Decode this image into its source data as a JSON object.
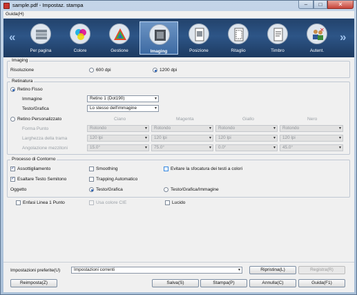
{
  "window": {
    "title": "sample.pdf - Impostaz. stampa",
    "min": "–",
    "max": "□",
    "close": "✕"
  },
  "menu": {
    "guida": "Guida(H)"
  },
  "toolbar": {
    "left": "«",
    "right": "»",
    "items": [
      {
        "label": "Per pagina",
        "icon": "pages-stack-icon"
      },
      {
        "label": "Colore",
        "icon": "color-circles-icon"
      },
      {
        "label": "Gestione",
        "icon": "color-management-icon"
      },
      {
        "label": "Imaging",
        "icon": "imaging-icon",
        "selected": true
      },
      {
        "label": "Posizione",
        "icon": "position-icon"
      },
      {
        "label": "Ritaglio",
        "icon": "crop-icon"
      },
      {
        "label": "Timbro",
        "icon": "stamp-icon"
      },
      {
        "label": "Autent.",
        "icon": "users-auth-icon"
      }
    ]
  },
  "imaging": {
    "title": "Imaging",
    "risoluzione": "Risoluzione",
    "dpi600": "600 dpi",
    "dpi1200": "1200 dpi"
  },
  "retinatura": {
    "title": "Retinatura",
    "fisso": "Retino Fisso",
    "immagine": "Immagine",
    "immagine_val": "Retino 1 (Dot190)",
    "grafica": "Testo/Grafica",
    "grafica_val": "Lo stesso dell'immagine",
    "personalizzato": "Retino Personalizzato",
    "cols": [
      "Ciano",
      "Magenta",
      "Giallo",
      "Nero"
    ],
    "rows": [
      {
        "label": "Forma Punto",
        "vals": [
          "Rotondo",
          "Rotondo",
          "Rotondo",
          "Rotondo"
        ]
      },
      {
        "label": "Larghezza della trama",
        "vals": [
          "120 lpi",
          "120 lpi",
          "120 lpi",
          "120 lpi"
        ]
      },
      {
        "label": "Angolazione mezzitoni",
        "vals": [
          "15.0°",
          "75.0°",
          "0.0°",
          "45.0°"
        ]
      }
    ]
  },
  "contorno": {
    "title": "Processo di Contorno",
    "assottigliamento": "Assottigliamento",
    "smoothing": "Smoothing",
    "evitare": "Evitare la sfocatura dei testi a colori",
    "esaltare": "Esaltare Testo Semitono",
    "trapping": "Trapping Automatico",
    "oggetto": "Oggetto",
    "tg": "Testo/Grafica",
    "tgi": "Testo/Grafica/Immagine"
  },
  "extra": {
    "enfasi": "Enfasi Linea 1 Punto",
    "cie": "Usa colore CIE",
    "lucido": "Lucido"
  },
  "bottom": {
    "preferite": "Impostazioni preferite(U)",
    "correnti": "Impostazioni correnti",
    "ripristina": "Ripristina(L)",
    "registra": "Registra(R)",
    "reimposta": "Reimposta(Z)",
    "salva": "Salva(S)",
    "stampa": "Stampa(P)",
    "annulla": "Annulla(C)",
    "guida": "Guida(F1)"
  }
}
